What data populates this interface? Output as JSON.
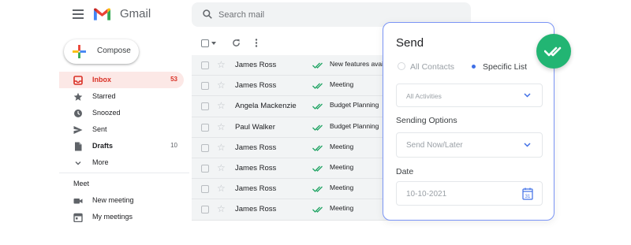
{
  "header": {
    "app_name": "Gmail",
    "search_placeholder": "Search mail"
  },
  "compose": {
    "label": "Compose"
  },
  "sidebar": {
    "items": [
      {
        "label": "Inbox",
        "count": "53",
        "icon": "inbox-icon",
        "active": true
      },
      {
        "label": "Starred",
        "count": "",
        "icon": "star-icon"
      },
      {
        "label": "Snoozed",
        "count": "",
        "icon": "clock-icon"
      },
      {
        "label": "Sent",
        "count": "",
        "icon": "send-icon"
      },
      {
        "label": "Drafts",
        "count": "10",
        "icon": "draft-icon",
        "bold": true
      },
      {
        "label": "More",
        "count": "",
        "icon": "chevron-down-icon"
      }
    ],
    "meet_heading": "Meet",
    "meet_items": [
      {
        "label": "New meeting",
        "icon": "video-icon"
      },
      {
        "label": "My meetings",
        "icon": "calendar-icon"
      }
    ]
  },
  "emails": [
    {
      "sender": "James Ross",
      "subject": "New features available"
    },
    {
      "sender": "James Ross",
      "subject": "Meeting"
    },
    {
      "sender": "Angela Mackenzie",
      "subject": "Budget Planning"
    },
    {
      "sender": "Paul Walker",
      "subject": "Budget Planning"
    },
    {
      "sender": "James Ross",
      "subject": "Meeting"
    },
    {
      "sender": "James Ross",
      "subject": "Meeting"
    },
    {
      "sender": "James Ross",
      "subject": "Meeting"
    },
    {
      "sender": "James Ross",
      "subject": "Meeting"
    }
  ],
  "send_panel": {
    "title": "Send",
    "audience_options": [
      "All Contacts",
      "Specific List"
    ],
    "selected_audience": "Specific List",
    "list_select": "All Activities",
    "sending_options_label": "Sending Options",
    "sending_options_value": "Send Now/Later",
    "date_label": "Date",
    "date_value": "10-10-2021",
    "calendar_day": "31"
  },
  "colors": {
    "accent_blue": "#3f6fe6",
    "panel_border": "#7a94f5",
    "badge_green": "#22b573",
    "inbox_red": "#d93025",
    "tick_green": "#1fa463"
  }
}
